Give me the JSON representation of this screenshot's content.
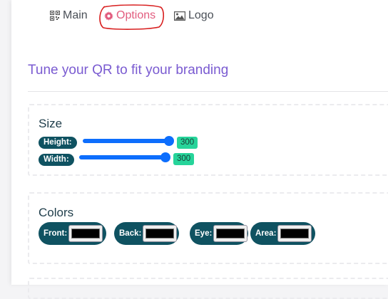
{
  "tabs": [
    {
      "label": "Main",
      "icon": "qr-code-icon",
      "active": false
    },
    {
      "label": "Options",
      "icon": "gear-icon",
      "active": true
    },
    {
      "label": "Logo",
      "icon": "image-icon",
      "active": false
    }
  ],
  "heading": "Tune your QR to fit your branding",
  "size": {
    "legend": "Size",
    "height": {
      "label": "Height:",
      "value": "300"
    },
    "width": {
      "label": "Width:",
      "value": "300"
    }
  },
  "colors": {
    "legend": "Colors",
    "items": [
      {
        "label": "Front:",
        "value": "#000000"
      },
      {
        "label": "Back:",
        "value": "#000000"
      },
      {
        "label": "Eye:",
        "value": "#000000"
      },
      {
        "label": "Area:",
        "value": "#000000"
      }
    ]
  },
  "theme": {
    "active_tab": "#e25c7e",
    "heading": "#7a5bd1",
    "pill": "#0f5261",
    "slider": "#0d6efd",
    "value_badge": "#26d49a"
  }
}
